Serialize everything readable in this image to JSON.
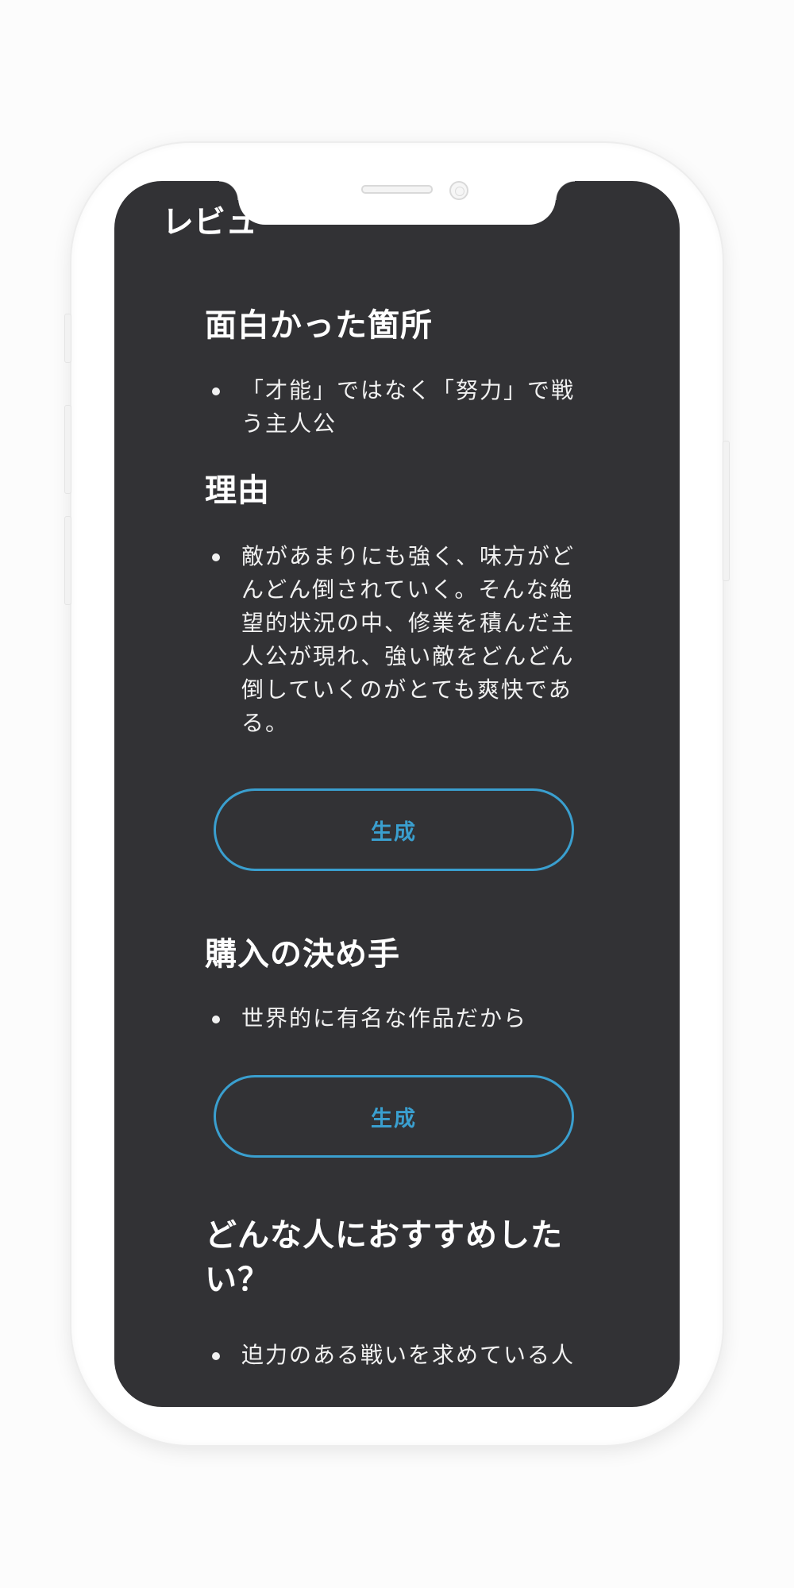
{
  "header": {
    "title": "レビュー"
  },
  "sections": [
    {
      "heading": "面白かった箇所",
      "items": [
        "「才能」ではなく「努力」で戦う主人公"
      ]
    },
    {
      "heading": "理由",
      "items": [
        "敵があまりにも強く、味方がどんどん倒されていく。そんな絶望的状況の中、修業を積んだ主人公が現れ、強い敵をどんどん倒していくのがとても爽快である。"
      ]
    },
    {
      "heading": "購入の決め手",
      "items": [
        "世界的に有名な作品だから"
      ]
    },
    {
      "heading": "どんな人におすすめしたい？",
      "items": [
        "迫力のある戦いを求めている人"
      ]
    }
  ],
  "buttons": {
    "generate_label": "生成"
  },
  "colors": {
    "screen_background": "#323235",
    "accent": "#3a9fcf",
    "text": "#ffffff",
    "device_frame": "#ffffff"
  }
}
